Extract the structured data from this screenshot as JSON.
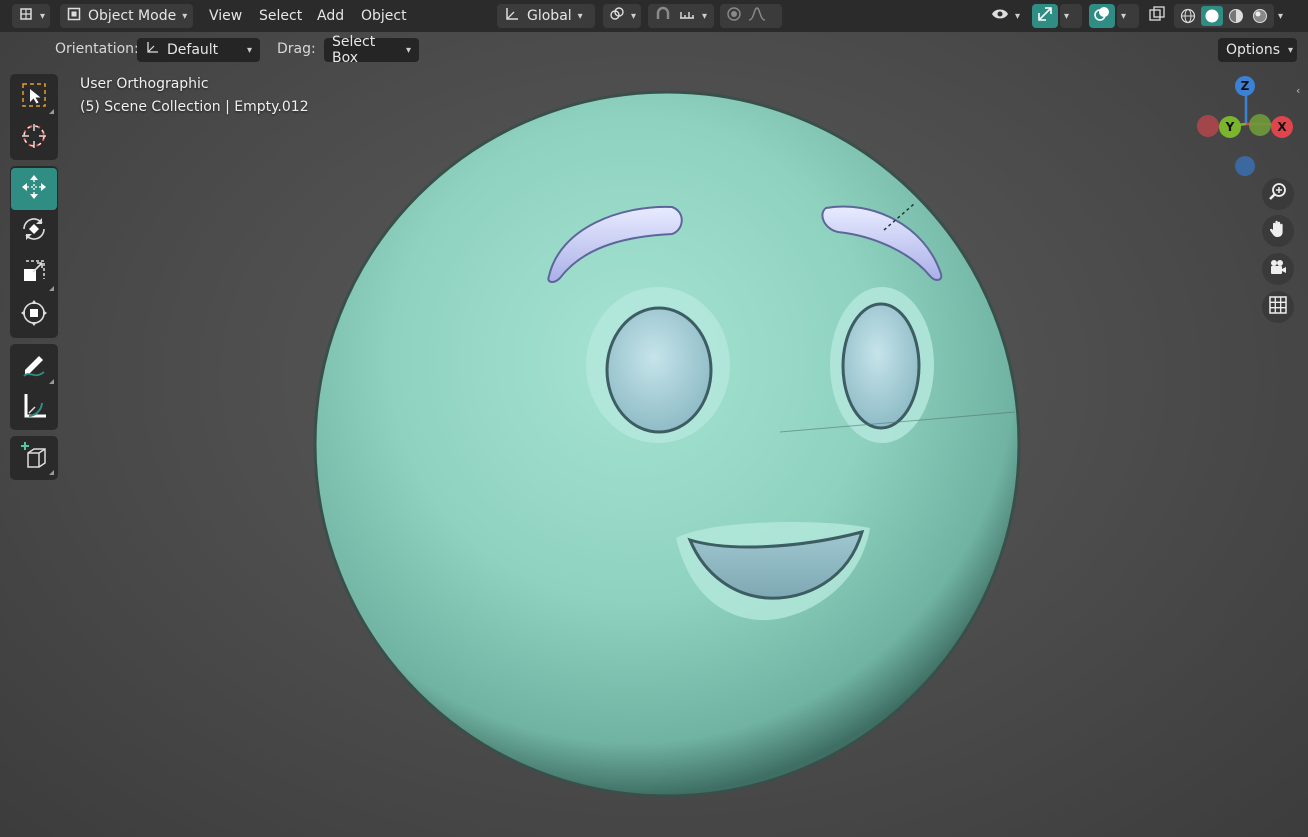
{
  "header": {
    "mode": "Object Mode",
    "menus": [
      "View",
      "Select",
      "Add",
      "Object"
    ],
    "transform_orientation": "Global"
  },
  "tool_settings": {
    "orientation_label": "Orientation:",
    "orientation_value": "Default",
    "drag_label": "Drag:",
    "drag_value": "Select Box",
    "options": "Options"
  },
  "viewport": {
    "view_name": "User Orthographic",
    "collection_info": "(5) Scene Collection | Empty.012"
  },
  "gizmo": {
    "z": "Z",
    "y": "Y",
    "x": "X"
  },
  "tools": [
    {
      "name": "select-box-icon",
      "active": false
    },
    {
      "name": "cursor-icon",
      "active": false
    },
    {
      "name": "move-icon",
      "active": true
    },
    {
      "name": "rotate-icon",
      "active": false
    },
    {
      "name": "scale-icon",
      "active": false
    },
    {
      "name": "transform-icon",
      "active": false
    },
    {
      "name": "annotate-icon",
      "active": false
    },
    {
      "name": "measure-icon",
      "active": false
    },
    {
      "name": "add-cube-icon",
      "active": false
    }
  ],
  "colors": {
    "accent": "#2f8d84",
    "mesh": "#8fd2c0",
    "axis_x": "#e0454e",
    "axis_y": "#7ab52d",
    "axis_z": "#3b82d6"
  }
}
